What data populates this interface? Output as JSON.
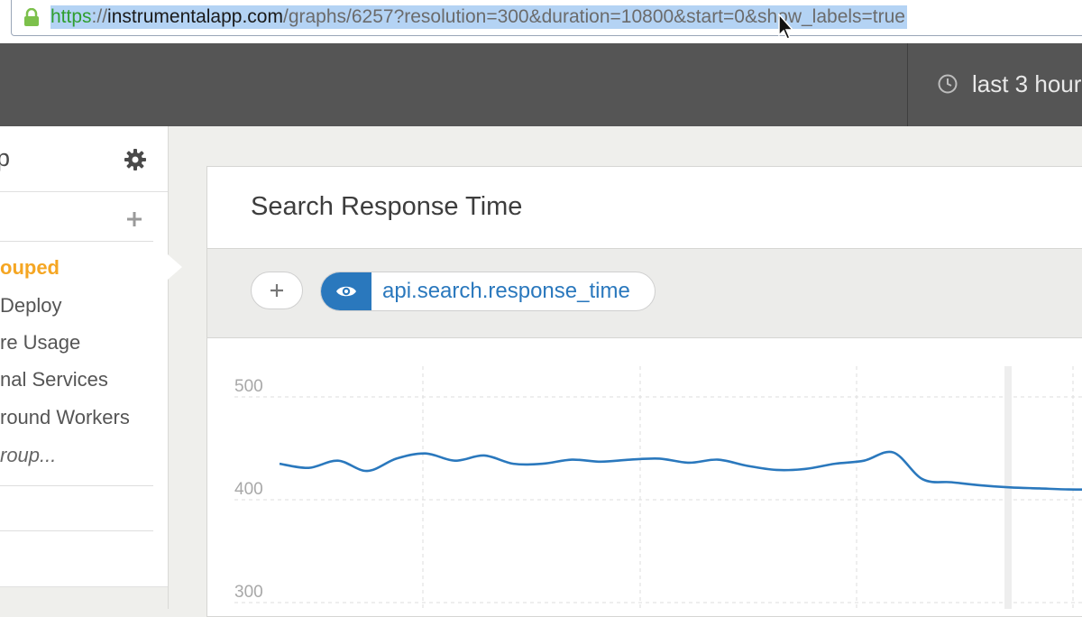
{
  "browser": {
    "url_scheme": "https",
    "url_scheme_sep": "://",
    "url_host": "instrumentalapp.com",
    "url_path": "/graphs/6257?resolution=300&duration=10800&start=0&show_labels=true",
    "lock_icon": "lock-icon",
    "cursor_icon": "arrow-cursor-icon"
  },
  "header": {
    "time_range_label": "last 3 hour",
    "clock_icon": "clock-icon"
  },
  "sidebar": {
    "title": "p",
    "gear_icon": "gear-icon",
    "add_icon": "plus-icon",
    "items": [
      {
        "label": "ouped",
        "active": true
      },
      {
        "label": "Deploy",
        "active": false
      },
      {
        "label": "re Usage",
        "active": false
      },
      {
        "label": "nal Services",
        "active": false
      },
      {
        "label": "round Workers",
        "active": false
      },
      {
        "label": "roup...",
        "active": false
      }
    ],
    "active_color": "#f5a623"
  },
  "graph": {
    "title": "Search Response Time",
    "add_metric_icon": "plus-icon",
    "metric": {
      "name": "api.search.response_time",
      "visibility_icon": "eye-icon",
      "color": "#2a78bd"
    }
  },
  "chart_data": {
    "type": "line",
    "title": "",
    "xlabel": "",
    "ylabel": "",
    "ylim": [
      300,
      500
    ],
    "yticks": [
      500,
      400,
      300
    ],
    "grid": true,
    "series": [
      {
        "color": "#2a78bd",
        "x": [
          0,
          1,
          2,
          3,
          4,
          5,
          6,
          7,
          8,
          9,
          10,
          11,
          12,
          13,
          14,
          15,
          16,
          17,
          18,
          19,
          20,
          21,
          22,
          23,
          24,
          25,
          26,
          27,
          28,
          29
        ],
        "values": [
          435,
          431,
          438,
          428,
          440,
          445,
          438,
          443,
          435,
          435,
          439,
          437,
          439,
          440,
          436,
          439,
          433,
          429,
          430,
          435,
          438,
          446,
          420,
          417,
          414,
          412,
          411,
          410,
          410,
          410
        ]
      }
    ]
  }
}
